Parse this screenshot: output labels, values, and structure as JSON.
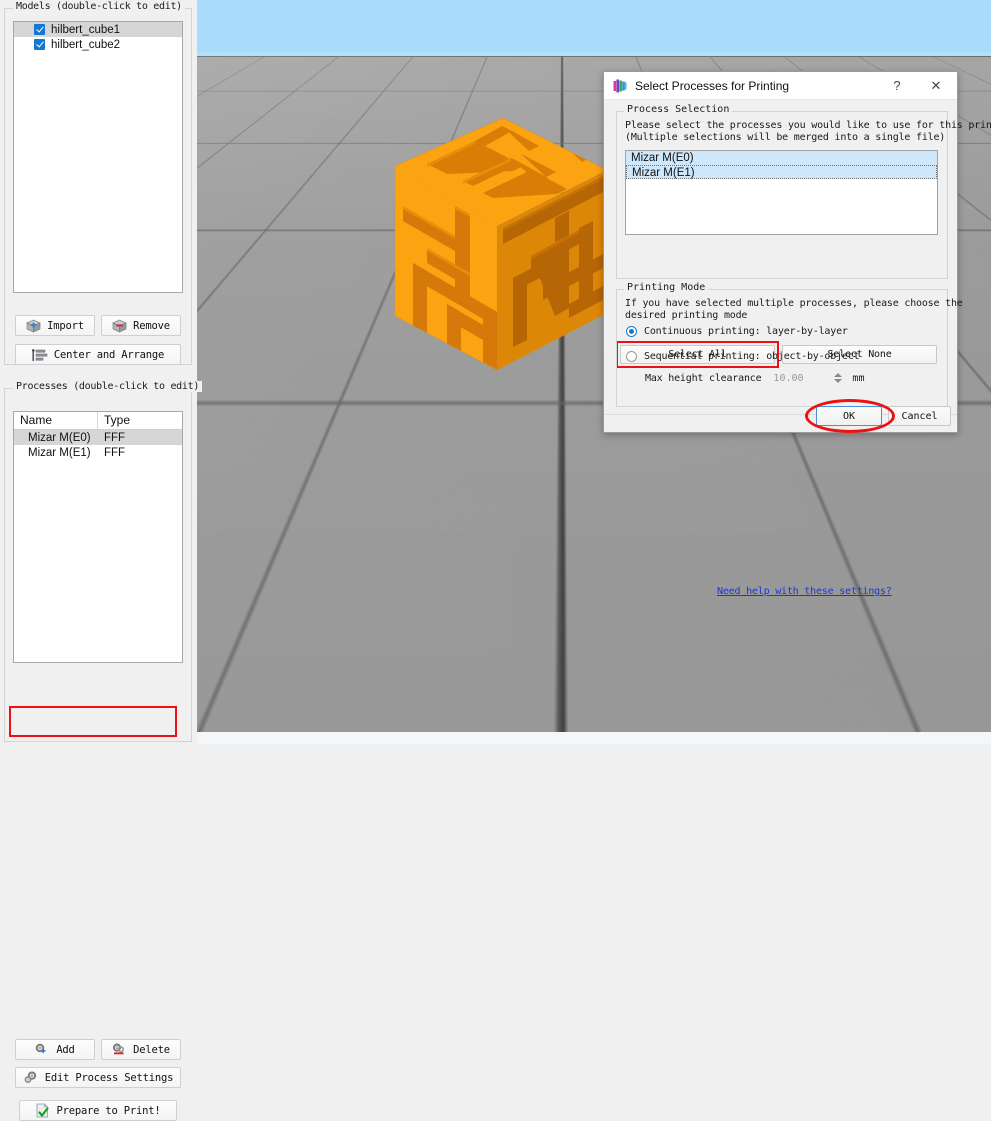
{
  "app": {
    "accent_blue": "#1278d4",
    "highlight_red": "#ee1111",
    "model_orange": "#f59b0b"
  },
  "left_panel": {
    "models_group": {
      "title": "Models (double-click to edit)",
      "items": [
        {
          "label": "hilbert_cube1",
          "checked": true,
          "selected": true
        },
        {
          "label": "hilbert_cube2",
          "checked": true,
          "selected": false
        }
      ],
      "buttons": [
        {
          "id": "import",
          "label": "Import",
          "icon": "import-cube-icon"
        },
        {
          "id": "remove",
          "label": "Remove",
          "icon": "remove-cube-icon"
        },
        {
          "id": "center_arrange",
          "label": "Center and Arrange",
          "icon": "center-arrange-icon"
        }
      ]
    },
    "processes_group": {
      "title": "Processes (double-click to edit)",
      "columns": [
        "Name",
        "Type"
      ],
      "rows": [
        {
          "name": "Mizar M(E0)",
          "type": "FFF",
          "selected": true
        },
        {
          "name": "Mizar M(E1)",
          "type": "FFF",
          "selected": false
        }
      ],
      "buttons": [
        {
          "id": "add",
          "label": "Add",
          "icon": "add-gear-icon"
        },
        {
          "id": "delete",
          "label": "Delete",
          "icon": "delete-gear-icon"
        },
        {
          "id": "edit_process_settings",
          "label": "Edit Process Settings",
          "icon": "gears-icon"
        },
        {
          "id": "prepare_to_print",
          "label": "Prepare to Print!",
          "icon": "prepare-print-icon",
          "highlighted": true
        }
      ]
    }
  },
  "viewport": {
    "sky_color": "#a9dcfb",
    "floor_color": "#9a9a9a",
    "model_name": "hilbert_cube",
    "model_color": "#f59b0b"
  },
  "dialog": {
    "title": "Select Processes for Printing",
    "icon": "simplify3d-logo-icon",
    "help_button": "?",
    "close_button": "✕",
    "process_selection": {
      "group_title": "Process Selection",
      "description_line1": "Please select the processes you would like to use for this print.",
      "description_line2": "(Multiple selections will be merged into a single file)",
      "items": [
        {
          "label": "Mizar M(E0)",
          "selected": true,
          "focused": false
        },
        {
          "label": "Mizar M(E1)",
          "selected": true,
          "focused": true
        }
      ],
      "select_all_label": "Select All",
      "select_none_label": "Select None",
      "select_all_highlighted": true
    },
    "printing_mode": {
      "group_title": "Printing Mode",
      "description_line1": "If you have selected multiple processes, please choose the",
      "description_line2": "desired printing mode",
      "continuous_label": "Continuous printing: layer-by-layer",
      "continuous_selected": true,
      "sequential_label": "Sequential printing: object-by-object",
      "sequential_selected": false,
      "clearance_label": "Max height clearance",
      "clearance_value": "10.00",
      "clearance_unit": "mm",
      "help_link": "Need help with these settings?"
    },
    "footer": {
      "ok_label": "OK",
      "cancel_label": "Cancel",
      "ok_highlighted": true
    }
  }
}
